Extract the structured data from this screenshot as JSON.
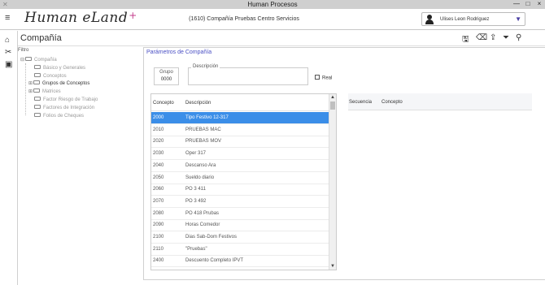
{
  "window": {
    "title": "Human Procesos",
    "minimize": "—",
    "maximize": "□",
    "close": "×"
  },
  "header": {
    "logo": "Human eLand",
    "logo_plus": "+",
    "company": "(1610) Compañía Pruebas Centro Servicios",
    "user_name": "Ulises Leon Rodriguez",
    "user_caret": "▼"
  },
  "toolbar": {
    "section": "Compañía",
    "icons": {
      "save": "🖫",
      "clear": "⌫",
      "export": "⇪",
      "filter": "⏷",
      "search": "⚲"
    }
  },
  "tree": {
    "filter_label": "Filtro",
    "root": "Compañía",
    "items": [
      "Básico y Generales",
      "Conceptos",
      "Grupos de Conceptos",
      "Matrices",
      "Factor Riesgo de Trabajo",
      "Factores de Integración",
      "Folios de Cheques"
    ]
  },
  "panel": {
    "title": "Parámetros de Compañía",
    "grupo_label": "Grupo",
    "grupo_value": "0000",
    "descripcion_label": "Descripción",
    "descripcion_value": "",
    "real_label": "Real"
  },
  "grid_left": {
    "columns": [
      "Concepto",
      "Descripción"
    ],
    "rows": [
      [
        "2000",
        "Tipo Festivo 12-317"
      ],
      [
        "2010",
        "PRUEBAS MAC"
      ],
      [
        "2020",
        "PRUEBAS MOV"
      ],
      [
        "2030",
        "Oper 317"
      ],
      [
        "2040",
        "Descanso Ara"
      ],
      [
        "2050",
        "Sueldo diario"
      ],
      [
        "2060",
        "PO 3 411"
      ],
      [
        "2070",
        "PO 3 492"
      ],
      [
        "2080",
        "PO 418 Prubas"
      ],
      [
        "2090",
        "Horas Comedor"
      ],
      [
        "2100",
        "Dias Sab-Dom Festivos"
      ],
      [
        "2110",
        "\"Pruebas\""
      ],
      [
        "2400",
        "Descuento Completo IPVT"
      ]
    ],
    "selected_index": 0
  },
  "grid_right": {
    "columns": [
      "Secuencia",
      "Concepto"
    ]
  }
}
